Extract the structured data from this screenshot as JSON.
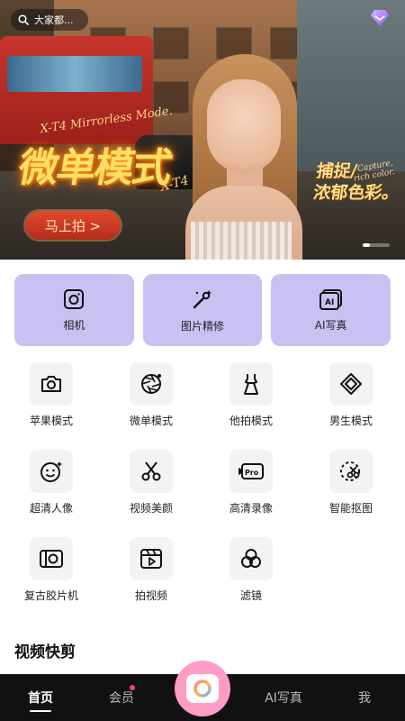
{
  "banner": {
    "search_placeholder": "大家都...",
    "title_en": "X-T4 Mirrorless Mode.",
    "title_cn": "微单模式",
    "title_sub": "X-T4",
    "cta_label": "马上拍 >",
    "slogan_line1": "捕捉/",
    "slogan_line2": "浓郁色彩。",
    "slogan_en_line1": "Capture,",
    "slogan_en_line2": "rich color."
  },
  "primary_cards": [
    {
      "label": "相机",
      "icon": "camera-icon"
    },
    {
      "label": "图片精修",
      "icon": "retouch-brush-icon"
    },
    {
      "label": "AI写真",
      "icon": "ai-portrait-icon"
    }
  ],
  "features": [
    {
      "label": "苹果模式",
      "icon": "camera-icon"
    },
    {
      "label": "微单模式",
      "icon": "aperture-icon"
    },
    {
      "label": "他拍模式",
      "icon": "dress-icon"
    },
    {
      "label": "男生模式",
      "icon": "diamond-icon"
    },
    {
      "label": "超清人像",
      "icon": "smile-face-icon"
    },
    {
      "label": "视频美颜",
      "icon": "scissors-icon"
    },
    {
      "label": "高清录像",
      "icon": "pro-video-icon"
    },
    {
      "label": "智能抠图",
      "icon": "cutout-icon"
    },
    {
      "label": "复古胶片机",
      "icon": "film-camera-icon"
    },
    {
      "label": "拍视频",
      "icon": "video-clapper-icon"
    },
    {
      "label": "滤镜",
      "icon": "filter-circles-icon"
    }
  ],
  "section": {
    "title": "视频快剪"
  },
  "bottom_nav": {
    "home": "首页",
    "member": "会员",
    "ai_portrait": "AI写真",
    "me": "我"
  },
  "colors": {
    "card_purple": "#c8c2f3",
    "nav_bg": "#111111",
    "fab_pink": "#ff9cc6",
    "badge_pink": "#ff3d7a",
    "cta_red": "#d13e27"
  }
}
